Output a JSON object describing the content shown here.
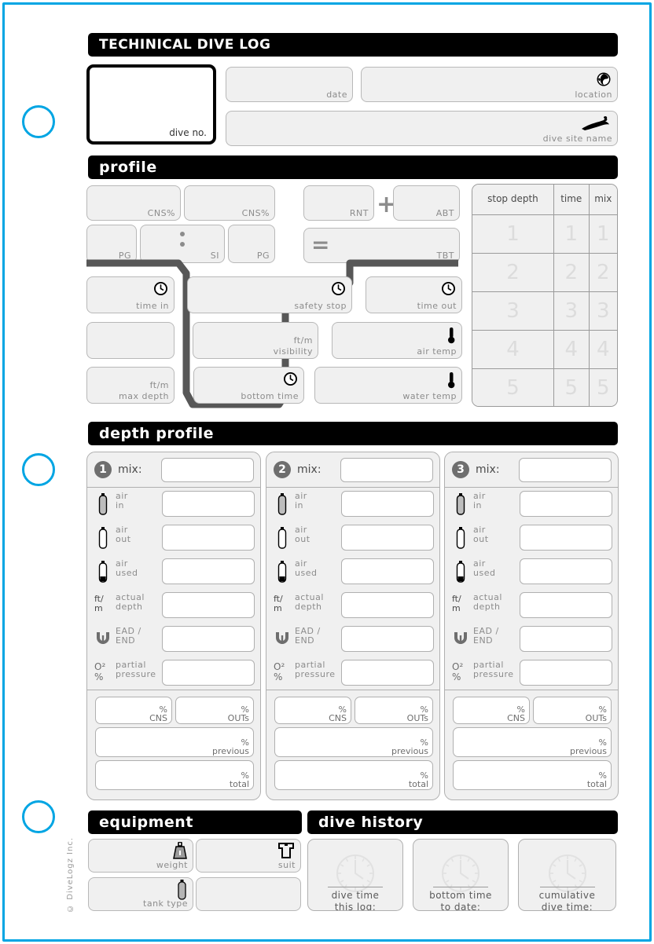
{
  "page": {
    "frame_color": "#00a5e3",
    "copyright": "© DiveLogz Inc.",
    "binder_holes": 3
  },
  "header": {
    "title": "TECHINICAL DIVE LOG",
    "dive_no_label": "dive no.",
    "date_label": "date",
    "location_label": "location",
    "location_icon": "globe-icon",
    "dive_site_label": "dive site name",
    "dive_site_icon": "diver-icon"
  },
  "profile": {
    "section_title": "profile",
    "cns1_label": "CNS%",
    "cns2_label": "CNS%",
    "pg1_label": "PG",
    "si_label": "SI",
    "pg2_label": "PG",
    "rnt_label": "RNT",
    "plus_symbol": "+",
    "abt_label": "ABT",
    "equals_symbol": "=",
    "tbt_label": "TBT",
    "time_in_label": "time in",
    "time_in_icon": "clock-icon",
    "safety_stop_label": "safety stop",
    "safety_stop_icon": "clock-icon",
    "time_out_label": "time out",
    "time_out_icon": "clock-icon",
    "blank_label": "",
    "visibility_unit": "ft/m",
    "visibility_label": "visibility",
    "air_temp_label": "air temp",
    "air_temp_icon": "thermometer-icon",
    "max_depth_unit": "ft/m",
    "max_depth_label": "max depth",
    "bottom_time_label": "bottom time",
    "bottom_time_icon": "clock-icon",
    "water_temp_label": "water temp",
    "water_temp_icon": "thermometer-icon"
  },
  "stop_table": {
    "columns": [
      "stop depth",
      "time",
      "mix"
    ],
    "rows": [
      [
        "1",
        "1",
        "1"
      ],
      [
        "2",
        "2",
        "2"
      ],
      [
        "3",
        "3",
        "3"
      ],
      [
        "4",
        "4",
        "4"
      ],
      [
        "5",
        "5",
        "5"
      ]
    ]
  },
  "depth_profile": {
    "section_title": "depth profile",
    "row_labels": {
      "mix": "mix:",
      "air_in": "air\nin",
      "air_out": "air\nout",
      "air_used": "air\nused",
      "actual_depth_unit": "ft/\nm",
      "actual_depth": "actual\ndepth",
      "ead_end": "EAD /\nEND",
      "o2_unit": "O²\n%",
      "partial_pressure": "partial\npressure"
    },
    "row_icons": {
      "air_in": "tank-full-icon",
      "air_out": "tank-empty-icon",
      "air_used": "tank-used-icon",
      "ead_end": "depth-gauge-icon"
    },
    "footer_labels": {
      "cns": "%\nCNS",
      "outs": "%\nOUTs",
      "previous": "%\nprevious",
      "total": "%\ntotal"
    },
    "panels": [
      {
        "number": "1"
      },
      {
        "number": "2"
      },
      {
        "number": "3"
      }
    ]
  },
  "equipment": {
    "section_title": "equipment",
    "weight_label": "weight",
    "weight_icon": "weight-icon",
    "suit_label": "suit",
    "suit_icon": "wetsuit-icon",
    "tank_type_label": "tank type",
    "tank_type_icon": "tank-icon",
    "blank_label": ""
  },
  "dive_history": {
    "section_title": "dive history",
    "items": [
      {
        "label": "dive time\nthis log:",
        "icon": "clock-icon"
      },
      {
        "label": "bottom time\nto date:",
        "icon": "clock-icon"
      },
      {
        "label": "cumulative\ndive time:",
        "icon": "clock-icon"
      }
    ]
  }
}
